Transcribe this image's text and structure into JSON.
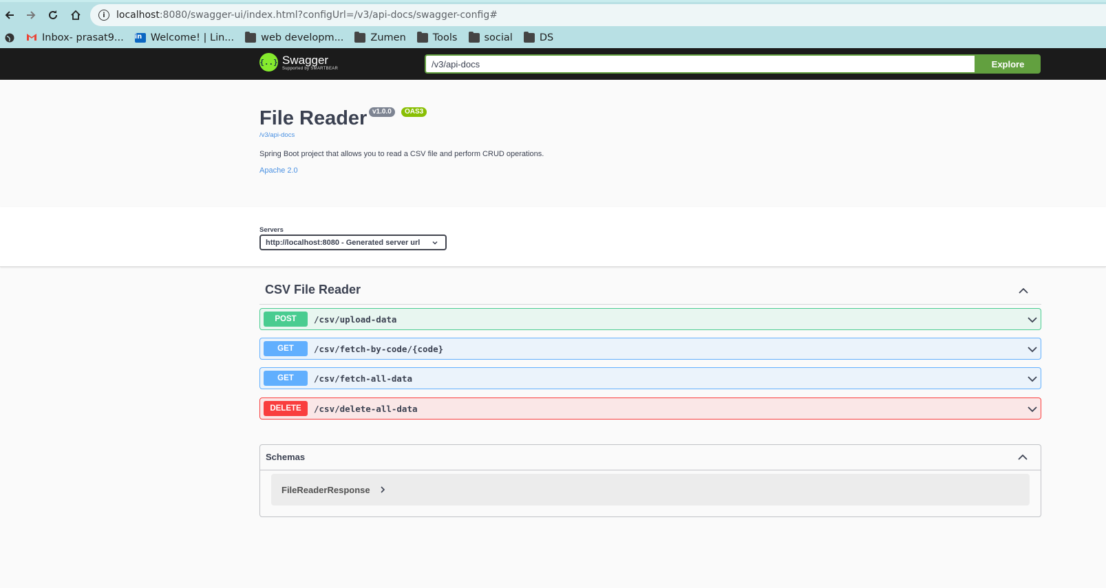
{
  "browser": {
    "url_host": "localhost",
    "url_rest": ":8080/swagger-ui/index.html?configUrl=/v3/api-docs/swagger-config#",
    "bookmarks": [
      {
        "label": "Inbox- prasat9...",
        "icon": "gmail-icon"
      },
      {
        "label": "Welcome! | Lin...",
        "icon": "linkedin-icon"
      },
      {
        "label": "web developm...",
        "icon": "folder-icon"
      },
      {
        "label": "Zumen",
        "icon": "folder-icon"
      },
      {
        "label": "Tools",
        "icon": "folder-icon"
      },
      {
        "label": "social",
        "icon": "folder-icon"
      },
      {
        "label": "DS",
        "icon": "folder-icon"
      }
    ]
  },
  "topbar": {
    "logo_text": "Swagger",
    "logo_sub": "Supported by SMARTBEAR",
    "api_url": "/v3/api-docs",
    "explore_label": "Explore",
    "accent": "#62a03f"
  },
  "info": {
    "title": "File Reader",
    "version": "v1.0.0",
    "oas": "OAS3",
    "spec_url": "/v3/api-docs",
    "description": "Spring Boot project that allows you to read a CSV file and perform CRUD operations.",
    "license": "Apache 2.0"
  },
  "servers": {
    "label": "Servers",
    "selected": "http://localhost:8080 - Generated server url"
  },
  "tag": {
    "name": "CSV File Reader",
    "operations": [
      {
        "method": "POST",
        "path": "/csv/upload-data",
        "color": "#49cc90"
      },
      {
        "method": "GET",
        "path": "/csv/fetch-by-code/{code}",
        "color": "#61affe"
      },
      {
        "method": "GET",
        "path": "/csv/fetch-all-data",
        "color": "#61affe"
      },
      {
        "method": "DELETE",
        "path": "/csv/delete-all-data",
        "color": "#f93e3e"
      }
    ]
  },
  "schemas": {
    "title": "Schemas",
    "models": [
      "FileReaderResponse"
    ]
  }
}
